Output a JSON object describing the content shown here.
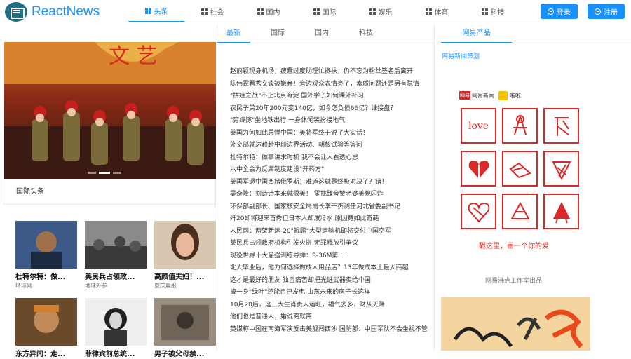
{
  "header": {
    "logo_text": "ReactNews",
    "nav": [
      {
        "label": "头条",
        "active": true
      },
      {
        "label": "社会",
        "active": false
      },
      {
        "label": "国内",
        "active": false
      },
      {
        "label": "国际",
        "active": false
      },
      {
        "label": "娱乐",
        "active": false
      },
      {
        "label": "体育",
        "active": false
      },
      {
        "label": "科技",
        "active": false
      }
    ],
    "login_label": "登录",
    "register_label": "注册",
    "accent": "#1890ff"
  },
  "left": {
    "card_title": "国际头条",
    "thumbs": [
      {
        "title": "杜特尔特：做...",
        "source": "环球网"
      },
      {
        "title": "美民兵占领政...",
        "source": "地球外参"
      },
      {
        "title": "高颜值夫妇！...",
        "source": "重庆晨报"
      },
      {
        "title": "东方异闻：走...",
        "source": ""
      },
      {
        "title": "菲律宾前总统...",
        "source": ""
      },
      {
        "title": "男子被父母禁...",
        "source": ""
      }
    ]
  },
  "middle": {
    "tabs": [
      {
        "label": "最新",
        "active": true
      },
      {
        "label": "国际",
        "active": false
      },
      {
        "label": "国内",
        "active": false
      },
      {
        "label": "科技",
        "active": false
      }
    ],
    "news": [
      "赵丽颖现身机场，疲惫过度助理忙搀扶，仍不忘为粉丝签名后离开",
      "陈伟霆看秀交谈被嫌弃！旁边观众表情亮了，素质问题还是另有隐情",
      "\"拼娃之战\"不止北京海淀 国外学子如何课外补习",
      "农民子弟20年200元变140亿，如今怎负债66亿？谁接盘？",
      "\"穷嫁嫁\"坐地铁出行 一身休闲装扮接地气",
      "美国为何如此忌惮中国：美将军终于说了大实话！",
      "外交部就达赖赴中印边界活动、朝核试验等答问",
      "杜特尔特：做事讲求时机 我不会让人看透心思",
      "六中全会为反腐制度建设\"开药方\"",
      "美国军退中国西堵俄罗斯：难道这就是终极对决了？错！",
      "吴奇隆：刘诗诗本来就很美！  零找臻夸赞老婆美貌闪炸",
      "环保部副部长、国家核安全局局长李干杰调任河北省委副书记",
      "歼20即将迎来首秀但日本人却泼冷水 原因竟如此奇葩",
      "人民网：两架新运-20\"鲲鹏\"大型运输机即将交付中国空军",
      "美民兵占领政府机构引发火拼 无罪释放引争议",
      "现役世界十大最强训练导弹：R-36M第一！",
      "北大毕业后，他为何选择做成人用品店？13年做成本土最大商超",
      "这才是最好的朋友 独自痛苦却把光进武器卖给中国",
      "披一身\"绿叶\"还能自己发电 山东未来的房子长这样",
      "10月28后，这三大生肖贵人运旺，福气多多，财从天降",
      "他们也是普通人，婚说离就离",
      "英媒称中国在南海军演反击美舰闯西沙 国防部：中国军队不会坐视不管"
    ]
  },
  "right": {
    "tab_label": "网易产品",
    "link_text": "网易新闻策划",
    "brand_163": "网易新闻",
    "brand_163_badge": "网易",
    "brand_lala": "啦啦",
    "cell_first_text": "love",
    "promo_caption": "戳这里，画一个你的爱",
    "studio_caption": "网易沸点工作室出品",
    "promo_red": "#d92a2a"
  }
}
